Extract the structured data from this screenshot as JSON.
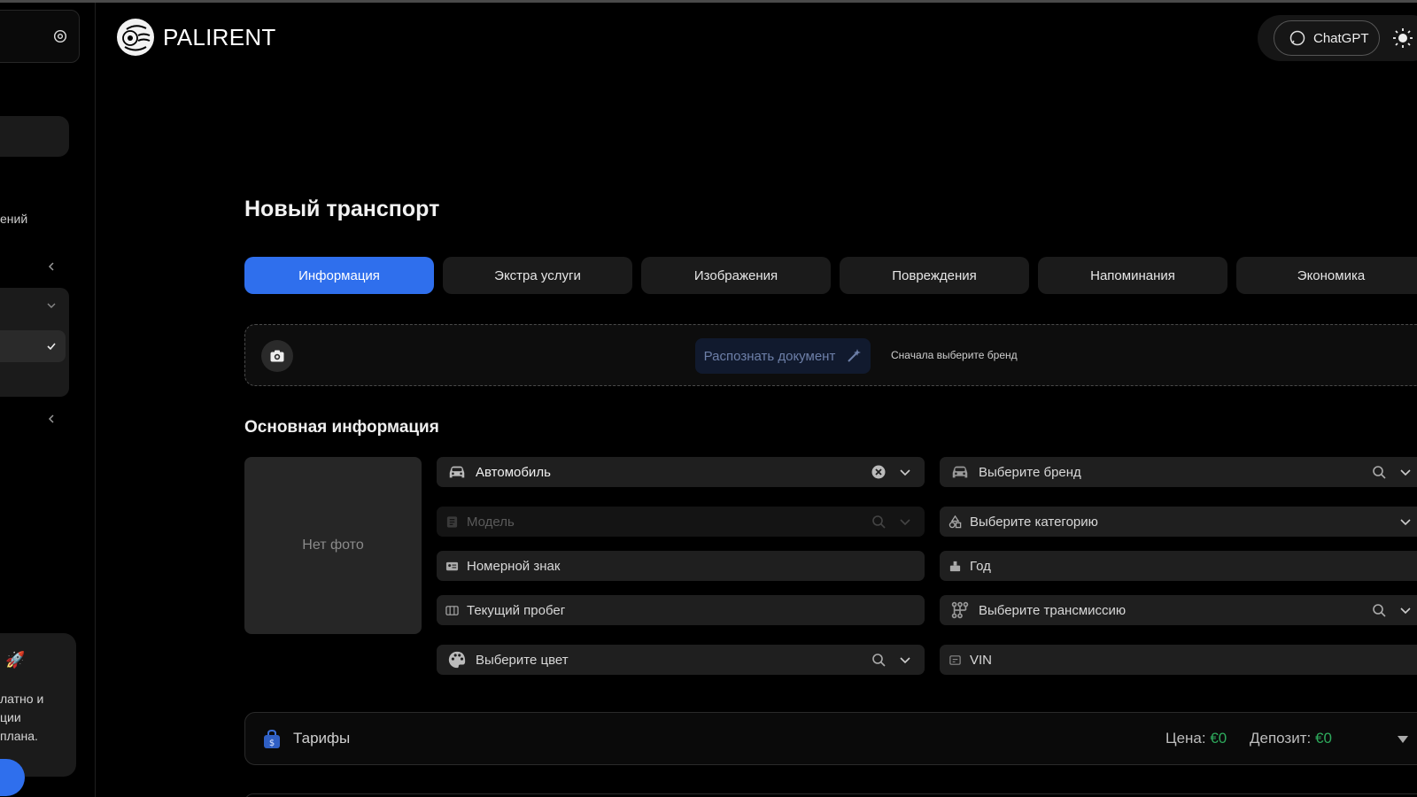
{
  "app": {
    "name": "PALIRENT"
  },
  "header": {
    "chatgpt_label": "ChatGPT"
  },
  "sidebar": {
    "section_label": "ений",
    "promo_text": "латно и\nции\nплана."
  },
  "page": {
    "title": "Новый транспорт"
  },
  "tabs": [
    {
      "label": "Информация",
      "active": true
    },
    {
      "label": "Экстра услуги",
      "active": false
    },
    {
      "label": "Изображения",
      "active": false
    },
    {
      "label": "Повреждения",
      "active": false
    },
    {
      "label": "Напоминания",
      "active": false
    },
    {
      "label": "Экономика",
      "active": false
    }
  ],
  "ocr": {
    "button_label": "Распознать документ",
    "hint": "Сначала выберите бренд"
  },
  "basic_info": {
    "title": "Основная информация",
    "photo_placeholder": "Нет фото",
    "vehicle_type": {
      "value": "Автомобиль",
      "icon": "car-icon"
    },
    "brand": {
      "placeholder": "Выберите бренд",
      "icon": "car-icon"
    },
    "model": {
      "placeholder": "Модель",
      "disabled": true,
      "icon": "document-icon"
    },
    "category": {
      "placeholder": "Выберите категорию",
      "icon": "shapes-icon"
    },
    "plate": {
      "placeholder": "Номерной знак",
      "icon": "id-card-icon"
    },
    "year": {
      "placeholder": "Год",
      "icon": "calendar-icon"
    },
    "mileage": {
      "placeholder": "Текущий пробег",
      "icon": "odometer-icon"
    },
    "transmission": {
      "placeholder": "Выберите трансмиссию",
      "icon": "gearbox-icon"
    },
    "color": {
      "placeholder": "Выберите цвет",
      "icon": "palette-icon"
    },
    "vin": {
      "placeholder": "VIN",
      "icon": "vin-icon"
    }
  },
  "tariffs": {
    "title": "Тарифы",
    "price_label": "Цена:",
    "price_value": "€0",
    "deposit_label": "Депозит:",
    "deposit_value": "€0"
  },
  "colors": {
    "accent": "#2f6fed",
    "background": "#000000",
    "field": "#1f1f1f",
    "money": "#2eaa5c"
  }
}
